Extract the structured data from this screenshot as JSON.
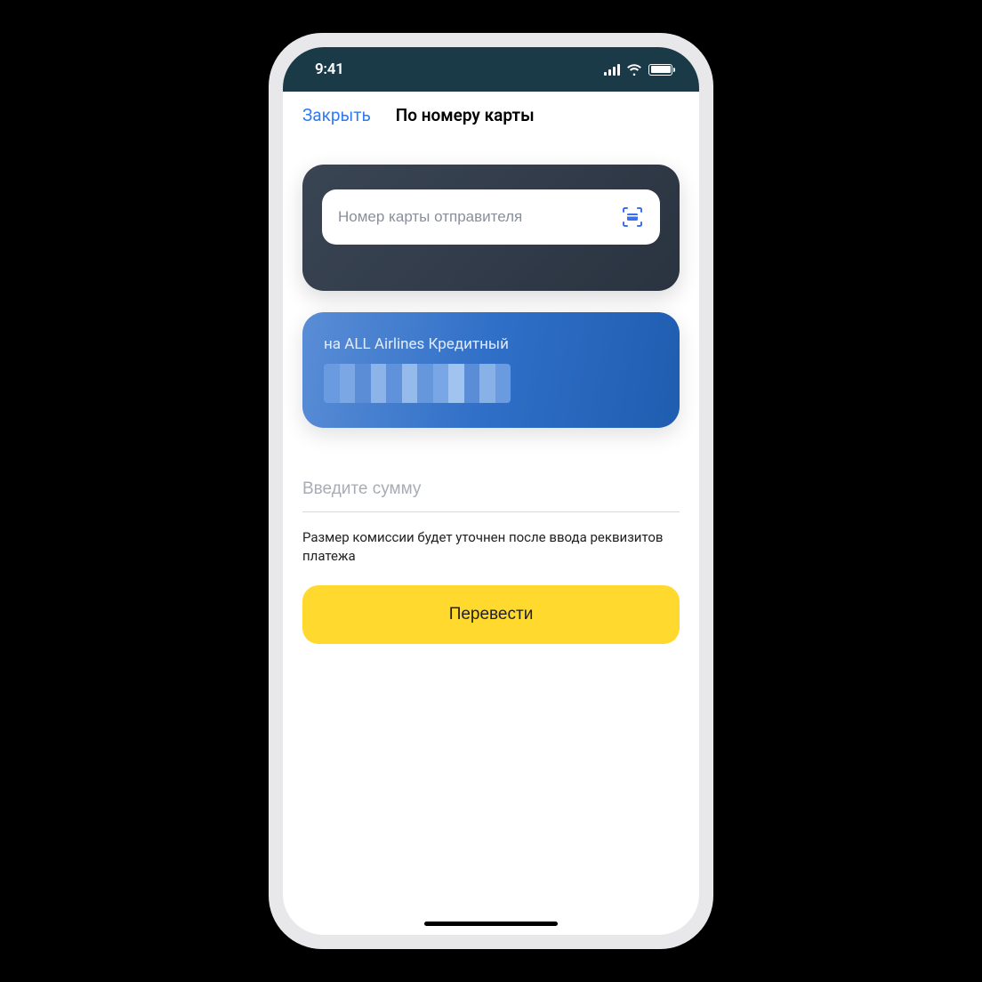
{
  "status": {
    "time": "9:41"
  },
  "nav": {
    "close": "Закрыть",
    "title": "По номеру карты"
  },
  "sender": {
    "placeholder": "Номер карты отправителя"
  },
  "recipient": {
    "label": "на ALL Airlines Кредитный"
  },
  "amount": {
    "placeholder": "Введите сумму"
  },
  "commission_note": "Размер комиссии будет уточнен после ввода реквизитов платежа",
  "actions": {
    "transfer": "Перевести"
  }
}
